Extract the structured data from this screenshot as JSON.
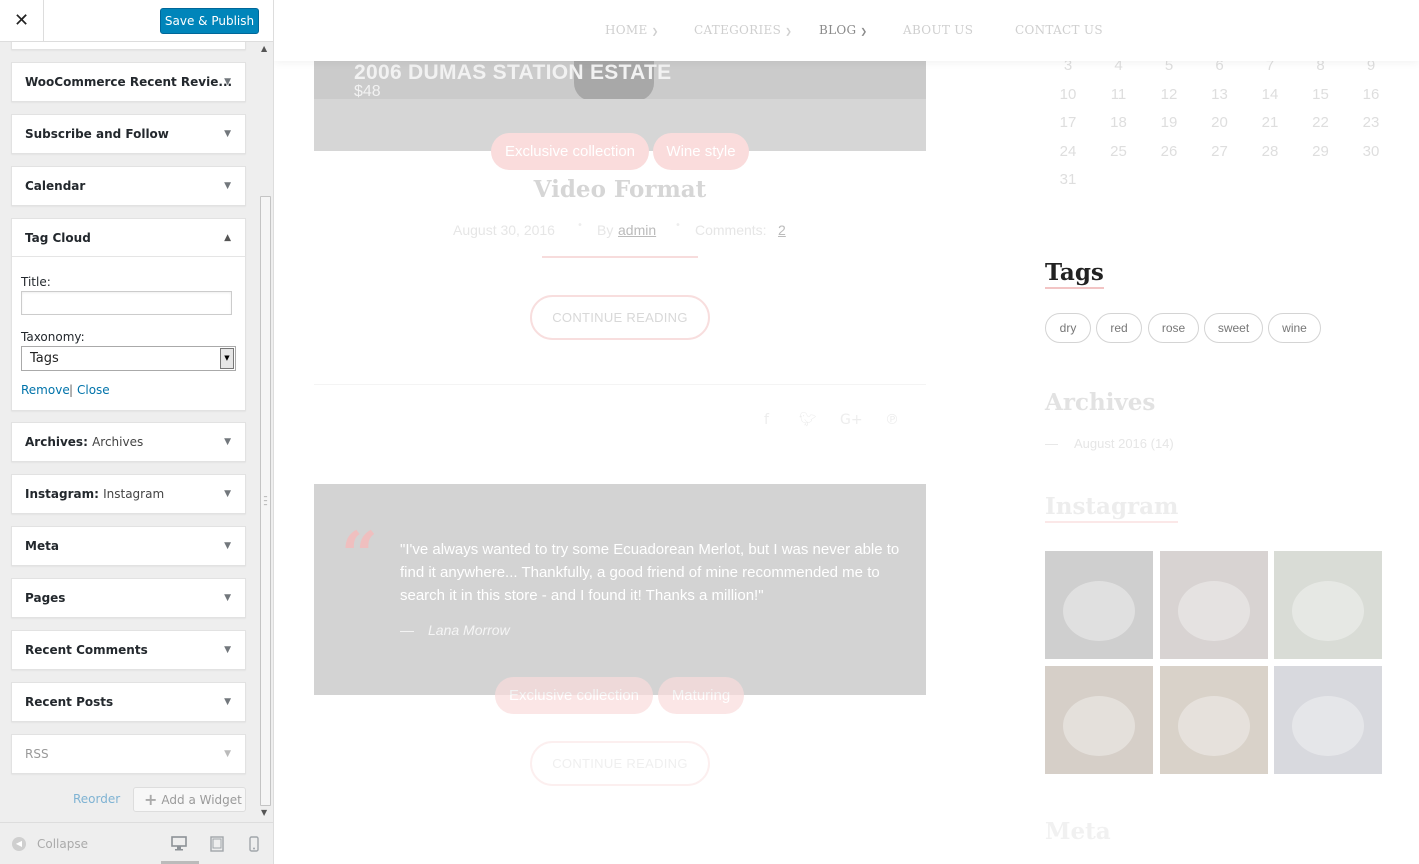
{
  "customizer": {
    "save_label": "Save & Publish",
    "close_symbol": "✕",
    "widgets": [
      {
        "title": "WooCommerce Recent Revie...",
        "subtitle": ""
      },
      {
        "title": "Subscribe and Follow",
        "subtitle": ""
      },
      {
        "title": "Calendar",
        "subtitle": ""
      },
      {
        "title": "Tag Cloud",
        "subtitle": "",
        "expanded": true
      },
      {
        "title": "Archives:",
        "subtitle": "Archives"
      },
      {
        "title": "Instagram:",
        "subtitle": "Instagram"
      },
      {
        "title": "Meta",
        "subtitle": ""
      },
      {
        "title": "Pages",
        "subtitle": ""
      },
      {
        "title": "Recent Comments",
        "subtitle": ""
      },
      {
        "title": "Recent Posts",
        "subtitle": ""
      },
      {
        "title": "RSS",
        "subtitle": ""
      }
    ],
    "tag_cloud_form": {
      "title_label": "Title:",
      "title_value": "",
      "taxonomy_label": "Taxonomy:",
      "taxonomy_value": "Tags",
      "remove_link": "Remove",
      "separator": "|",
      "close_link": "Close"
    },
    "reorder_label": "Reorder",
    "add_widget_label": "Add a Widget",
    "collapse_label": "Collapse"
  },
  "preview": {
    "nav": [
      {
        "label": "HOME",
        "has_dropdown": true
      },
      {
        "label": "CATEGORIES",
        "has_dropdown": true
      },
      {
        "label": "BLOG",
        "has_dropdown": true,
        "active": true
      },
      {
        "label": "ABOUT US",
        "has_dropdown": false
      },
      {
        "label": "CONTACT US",
        "has_dropdown": false
      }
    ],
    "post1": {
      "banner_title": "2006 DUMAS STATION ESTATE",
      "banner_price": "$48",
      "tags": [
        "Exclusive collection",
        "Wine style"
      ],
      "title": "Video Format",
      "date": "August 30, 2016",
      "by_label": "By",
      "author": "admin",
      "comments_label": "Comments:",
      "comments_count": "2",
      "continue_label": "CONTINUE READING"
    },
    "post2": {
      "quote": "\"I've always wanted to try some Ecuadorean Merlot, but I was never able to find it anywhere... Thankfully, a good friend of mine recommended me to search it in this store - and I found it! Thanks a million!\"",
      "quote_dash": "—",
      "quote_author": "Lana Morrow",
      "tags": [
        "Exclusive collection",
        "Maturing"
      ],
      "continue_label": "CONTINUE READING"
    },
    "calendar_rows": [
      [
        "3",
        "4",
        "5",
        "6",
        "7",
        "8",
        "9"
      ],
      [
        "10",
        "11",
        "12",
        "13",
        "14",
        "15",
        "16"
      ],
      [
        "17",
        "18",
        "19",
        "20",
        "21",
        "22",
        "23"
      ],
      [
        "24",
        "25",
        "26",
        "27",
        "28",
        "29",
        "30"
      ],
      [
        "31"
      ]
    ],
    "tags_widget": {
      "title": "Tags",
      "tags": [
        "dry",
        "red",
        "rose",
        "sweet",
        "wine"
      ]
    },
    "archives_widget": {
      "title": "Archives",
      "dash": "—",
      "item": "August 2016 (14)"
    },
    "instagram_widget": {
      "title": "Instagram",
      "photo_colors": [
        "#cfcfcf",
        "#d8d3d2",
        "#d9dcd6",
        "#d6cfc8",
        "#d9d2c9",
        "#d8d9de"
      ]
    },
    "meta_widget": {
      "title": "Meta"
    },
    "social_icons": [
      "facebook-icon",
      "twitter-icon",
      "google-plus-icon",
      "pinterest-icon"
    ]
  },
  "colors": {
    "publish_blue": "#0085ba",
    "link_blue": "#0073aa",
    "accent_pink": "#fadcdc"
  }
}
